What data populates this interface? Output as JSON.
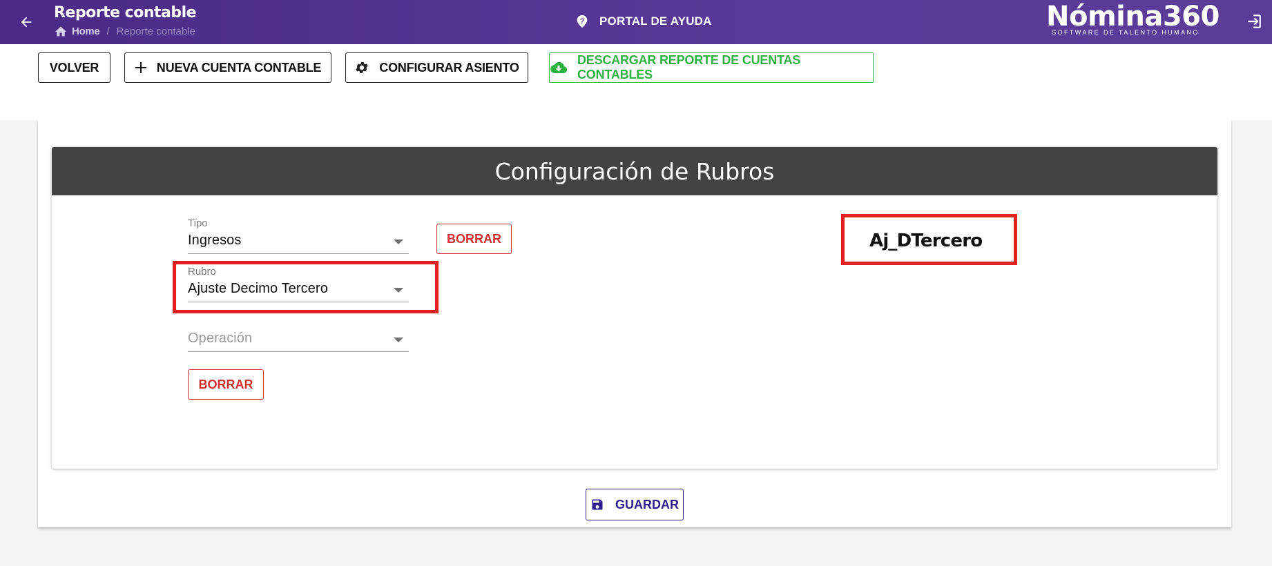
{
  "header": {
    "title": "Reporte contable",
    "breadcrumb": {
      "home": "Home",
      "current": "Reporte contable"
    },
    "help_label": "PORTAL DE AYUDA",
    "logo": {
      "name": "Nómina360",
      "tagline": "SOFTWARE DE TALENTO HUMANO"
    },
    "icons": {
      "back": "arrow-left-icon",
      "home": "home-icon",
      "help": "help-circle-icon",
      "logout": "logout-icon"
    }
  },
  "toolbar": {
    "back_label": "VOLVER",
    "new_account_label": "NUEVA CUENTA CONTABLE",
    "configure_label": "CONFIGURAR ASIENTO",
    "download_label": "DESCARGAR REPORTE DE CUENTAS CONTABLES",
    "icons": {
      "new_account": "plus-icon",
      "configure": "gear-icon",
      "download": "cloud-download-icon"
    }
  },
  "panel": {
    "title": "Configuración de Rubros",
    "tipo": {
      "label": "Tipo",
      "value": "Ingresos"
    },
    "rubro": {
      "label": "Rubro",
      "value": "Ajuste Decimo Tercero"
    },
    "operacion": {
      "placeholder": "Operación"
    },
    "clear_label_1": "BORRAR",
    "clear_label_2": "BORRAR",
    "code": "Aj_DTercero"
  },
  "footer": {
    "save_label": "GUARDAR",
    "save_icon": "save-icon"
  },
  "colors": {
    "header_purple": "#5a3a98",
    "panel_header": "#434343",
    "danger_red": "#d32f2f",
    "highlight_red": "#e31f22",
    "success_green": "#2db342",
    "save_navy": "#2d1f8f"
  }
}
